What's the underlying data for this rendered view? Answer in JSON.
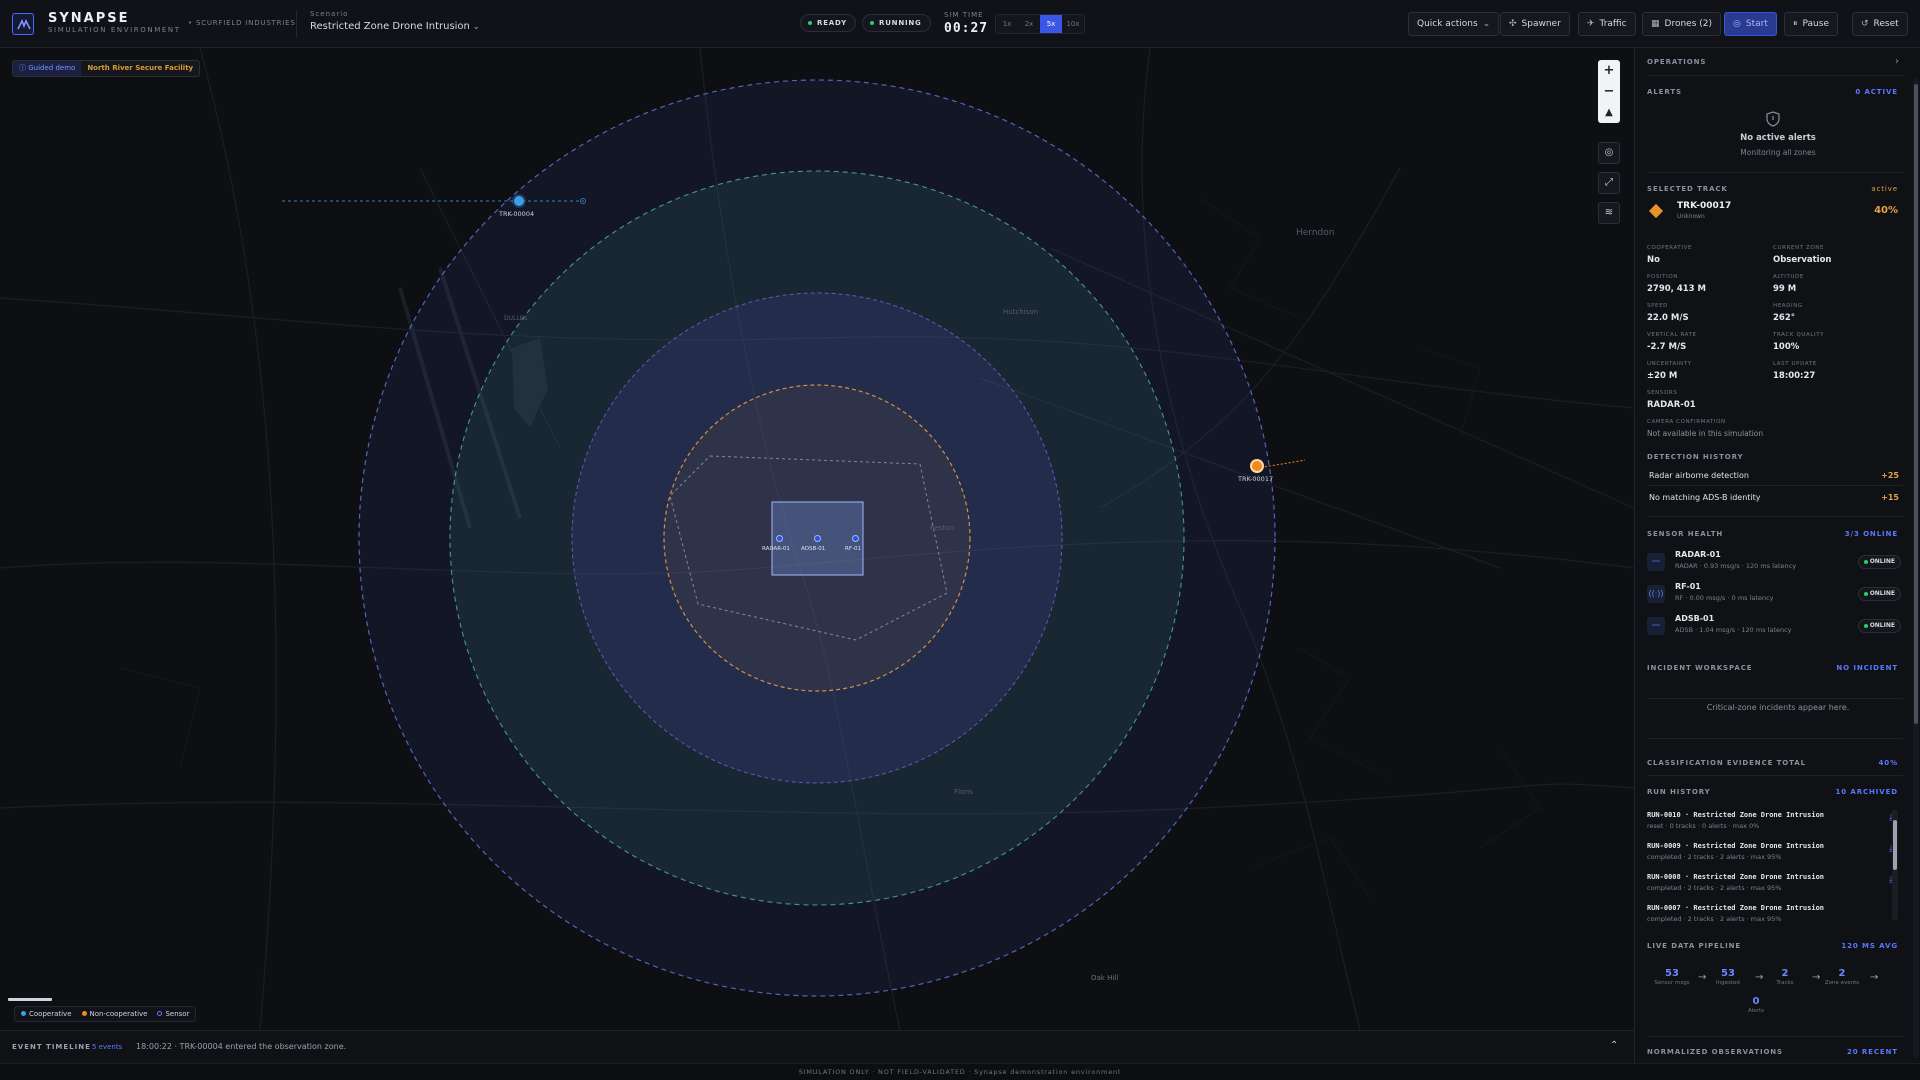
{
  "app": {
    "brand": "SYNAPSE",
    "brand_sub": "SIMULATION ENVIRONMENT",
    "org": "• SCURFIELD INDUSTRIES"
  },
  "scenario": {
    "label": "Scenario",
    "selected": "Restricted Zone Drone Intrusion"
  },
  "status": {
    "ready": "READY",
    "running": "RUNNING"
  },
  "sim_time": {
    "label": "SIM TIME",
    "value": "00:27"
  },
  "speeds": [
    "1x",
    "2x",
    "5x",
    "10x"
  ],
  "speed_active": "5x",
  "toolbar": {
    "quick_actions": "Quick actions",
    "spawner": "Spawner",
    "traffic": "Traffic",
    "drones": "Drones (2)",
    "start": "Start",
    "pause": "Pause",
    "reset": "Reset"
  },
  "map": {
    "guided_demo": "Guided demo",
    "facility": "North River Secure Facility",
    "place_labels": [
      "Herndon",
      "DULLES",
      "Hutchison",
      "Reston",
      "Floris",
      "Oak Hill"
    ],
    "tracks": [
      {
        "id": "TRK-00004",
        "type": "cooperative"
      },
      {
        "id": "TRK-00017",
        "type": "non-cooperative"
      }
    ],
    "sensor_labels": [
      "RADAR-01",
      "ADSB-01",
      "RF-01"
    ],
    "legend": [
      "Cooperative",
      "Non-cooperative",
      "Sensor"
    ],
    "legend_colors": {
      "cooperative": "#3aa0e8",
      "non_cooperative": "#f08a1c",
      "sensor": "#5a78ff"
    }
  },
  "timeline": {
    "label": "EVENT TIMELINE",
    "count": "5 events",
    "latest": "18:00:22 · TRK-00004 entered the observation zone."
  },
  "footer": "SIMULATION ONLY · NOT FIELD-VALIDATED · Synapse demonstration environment",
  "panel": {
    "title": "OPERATIONS",
    "alerts": {
      "label": "ALERTS",
      "count": "0 ACTIVE",
      "empty_title": "No active alerts",
      "empty_sub": "Monitoring all zones"
    },
    "selected_track": {
      "label": "SELECTED TRACK",
      "state": "active",
      "id": "TRK-00017",
      "classification": "Unknown",
      "confidence": "40%",
      "fields": [
        {
          "label": "COOPERATIVE",
          "value": "No"
        },
        {
          "label": "CURRENT ZONE",
          "value": "Observation"
        },
        {
          "label": "POSITION",
          "value": "2790, 413 M"
        },
        {
          "label": "ALTITUDE",
          "value": "99 M"
        },
        {
          "label": "SPEED",
          "value": "22.0 M/S"
        },
        {
          "label": "HEADING",
          "value": "262°"
        },
        {
          "label": "VERTICAL RATE",
          "value": "-2.7 M/S"
        },
        {
          "label": "TRACK QUALITY",
          "value": "100%"
        },
        {
          "label": "UNCERTAINTY",
          "value": "±20 M"
        },
        {
          "label": "LAST UPDATE",
          "value": "18:00:27"
        },
        {
          "label": "SENSORS",
          "value": "RADAR-01"
        }
      ],
      "camera_label": "CAMERA CONFIRMATION",
      "camera_value": "Not available in this simulation"
    },
    "detection_history": {
      "label": "DETECTION HISTORY",
      "items": [
        {
          "text": "Radar airborne detection",
          "points": "+25"
        },
        {
          "text": "No matching ADS-B identity",
          "points": "+15"
        }
      ]
    },
    "sensor_health": {
      "label": "SENSOR HEALTH",
      "count": "3/3 ONLINE",
      "items": [
        {
          "name": "RADAR-01",
          "detail": "RADAR · 0.93 msg/s · 120 ms latency",
          "status": "ONLINE"
        },
        {
          "name": "RF-01",
          "detail": "RF · 0.00 msg/s · 0 ms latency",
          "status": "ONLINE"
        },
        {
          "name": "ADSB-01",
          "detail": "ADSB · 1.04 msg/s · 120 ms latency",
          "status": "ONLINE"
        }
      ]
    },
    "incident": {
      "label": "INCIDENT WORKSPACE",
      "state": "NO INCIDENT",
      "empty": "Critical-zone incidents appear here."
    },
    "classification": {
      "label": "CLASSIFICATION EVIDENCE TOTAL",
      "value": "40%"
    },
    "run_history": {
      "label": "RUN HISTORY",
      "count": "10 ARCHIVED",
      "items": [
        {
          "title": "RUN-0010 · Restricted Zone Drone Intrusion",
          "sub": "reset · 0 tracks · 0 alerts · max 0%"
        },
        {
          "title": "RUN-0009 · Restricted Zone Drone Intrusion",
          "sub": "completed · 2 tracks · 2 alerts · max 95%"
        },
        {
          "title": "RUN-0008 · Restricted Zone Drone Intrusion",
          "sub": "completed · 2 tracks · 2 alerts · max 95%"
        },
        {
          "title": "RUN-0007 · Restricted Zone Drone Intrusion",
          "sub": "completed · 2 tracks · 2 alerts · max 95%"
        }
      ]
    },
    "pipeline": {
      "label": "LIVE DATA PIPELINE",
      "avg": "120 MS AVG",
      "stages": [
        {
          "value": "53",
          "label": "Sensor msgs"
        },
        {
          "value": "53",
          "label": "Ingested"
        },
        {
          "value": "2",
          "label": "Tracks"
        },
        {
          "value": "2",
          "label": "Zone events"
        },
        {
          "value": "0",
          "label": "Alerts"
        }
      ]
    },
    "observations": {
      "label": "NORMALIZED OBSERVATIONS",
      "count": "20 RECENT"
    }
  }
}
